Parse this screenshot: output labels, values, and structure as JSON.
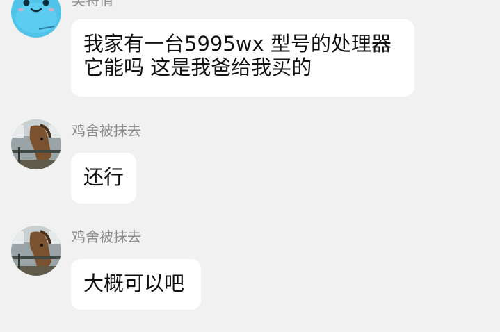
{
  "messages": [
    {
      "sender": "吴特情",
      "lines": [
        "我家有一台5995wx 型号的处理器",
        "它能吗 这是我爸给我买的"
      ],
      "avatar": "blue-cartoon-avatar-icon"
    },
    {
      "sender": "鸡舍被抹去",
      "lines": [
        "还行"
      ],
      "avatar": "horse-avatar-icon"
    },
    {
      "sender": "鸡舍被抹去",
      "lines": [
        "大概可以吧"
      ],
      "avatar": "horse-avatar-icon"
    }
  ],
  "colors": {
    "background": "#f1f1f1",
    "bubble": "#ffffff",
    "sender_text": "#8a8a8a",
    "message_text": "#111111",
    "cartoon_avatar": "#4fc3e8"
  }
}
